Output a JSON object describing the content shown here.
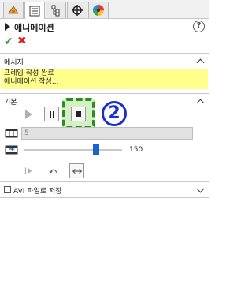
{
  "tabs": [
    {
      "icon": "feature-manager-icon",
      "active": false
    },
    {
      "icon": "property-manager-icon",
      "active": true
    },
    {
      "icon": "configuration-manager-icon",
      "active": false
    },
    {
      "icon": "dimxpert-manager-icon",
      "active": false
    },
    {
      "icon": "display-manager-icon",
      "active": false
    }
  ],
  "panel": {
    "title": "애니메이션",
    "help_icon": "?"
  },
  "actions": {
    "ok_symbol": "✔",
    "cancel_symbol": "✖"
  },
  "message": {
    "header": "메시지",
    "line1": "프레임 작성 완료",
    "line2": "애니메이션 작성..."
  },
  "basic": {
    "header": "기본",
    "frame_value": "5",
    "speed_value": "150",
    "speed_fraction": 0.73
  },
  "annotation": {
    "step_number": "2",
    "highlight_color": "#2d8b22",
    "marker_color": "#1a2fd0"
  },
  "avi": {
    "label": "AVI 파일로 저장",
    "checked": false
  },
  "colors": {
    "message_bg": "#ffff8c",
    "slider_thumb": "#1565d8",
    "ok": "#2c9a3a",
    "cancel": "#d9241c"
  }
}
